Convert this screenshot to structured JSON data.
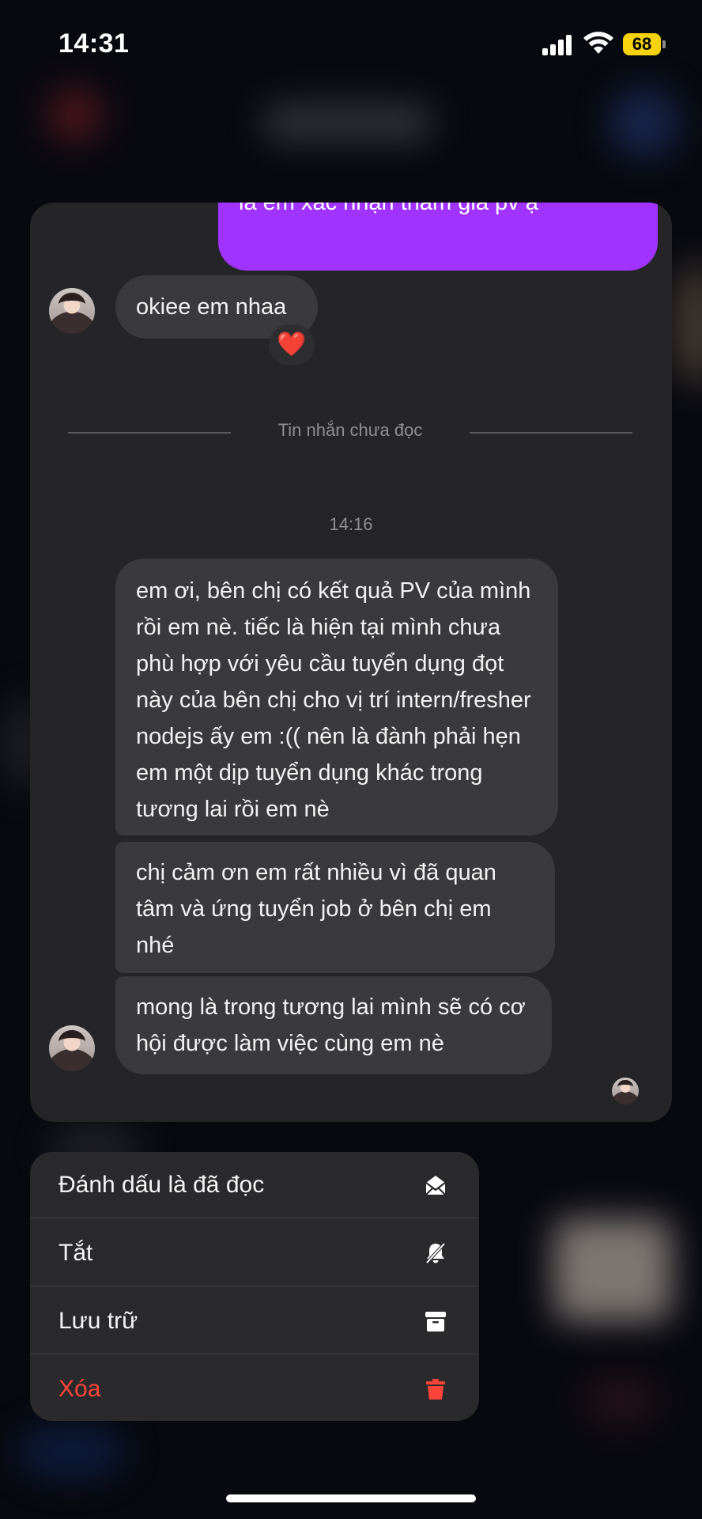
{
  "status_bar": {
    "time": "14:31",
    "battery_level": "68",
    "battery_color": "#f6d30c"
  },
  "chat": {
    "outgoing_message": "là em xác nhận tham gia pv ạ",
    "outgoing_color": "#a033ff",
    "incoming_short": "okiee em nhaa",
    "reaction": "❤️",
    "unread_divider": "Tin nhắn chưa đọc",
    "timestamp": "14:16",
    "messages": [
      "em ơi, bên chị có kết quả PV của mình rồi em nè. tiếc là hiện tại mình chưa phù hợp với yêu cầu tuyển dụng đọt này của bên chị cho vị trí intern/fresher nodejs ấy em :(( nên là đành phải hẹn em một dịp tuyển dụng khác trong tương lai rồi em nè",
      "chị cảm ơn em rất nhiều vì đã quan tâm và ứng tuyển job ở bên chị em nhé",
      "mong là trong tương lai mình sẽ có cơ hội được làm việc cùng em nè"
    ]
  },
  "context_menu": {
    "items": [
      {
        "label": "Đánh dấu là đã đọc",
        "icon": "envelope-open-icon"
      },
      {
        "label": "Tắt",
        "icon": "bell-slash-icon"
      },
      {
        "label": "Lưu trữ",
        "icon": "archive-box-icon"
      },
      {
        "label": "Xóa",
        "icon": "trash-icon",
        "color": "#ff453a"
      }
    ]
  }
}
